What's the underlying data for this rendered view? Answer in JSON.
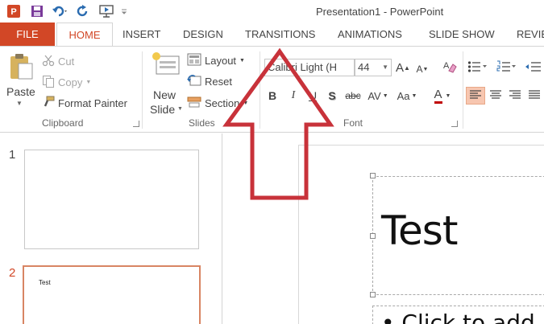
{
  "window": {
    "title": "Presentation1 - PowerPoint"
  },
  "tabs": [
    {
      "label": "FILE"
    },
    {
      "label": "HOME"
    },
    {
      "label": "INSERT"
    },
    {
      "label": "DESIGN"
    },
    {
      "label": "TRANSITIONS"
    },
    {
      "label": "ANIMATIONS"
    },
    {
      "label": "SLIDE SHOW"
    },
    {
      "label": "REVIE"
    }
  ],
  "clipboard": {
    "paste": "Paste",
    "cut": "Cut",
    "copy": "Copy",
    "format_painter": "Format Painter",
    "group": "Clipboard"
  },
  "slides_group": {
    "new_slide_1": "New",
    "new_slide_2": "Slide",
    "layout": "Layout",
    "reset": "Reset",
    "section": "Section",
    "group": "Slides"
  },
  "font": {
    "family": "Calibri Light (H",
    "size": "44",
    "group": "Font",
    "grow": "A",
    "shrink": "A",
    "bold": "B",
    "italic": "I",
    "underline": "U",
    "shadow": "S",
    "strike": "abc",
    "spacing": "AV",
    "case": "Aa",
    "color": "A"
  },
  "slides": [
    {
      "number": "1",
      "text": ""
    },
    {
      "number": "2",
      "text": "Test"
    }
  ],
  "editor": {
    "title": "Test",
    "body": "• Click to add"
  },
  "colors": {
    "accent": "#d24726",
    "arrow": "#c8323a"
  }
}
